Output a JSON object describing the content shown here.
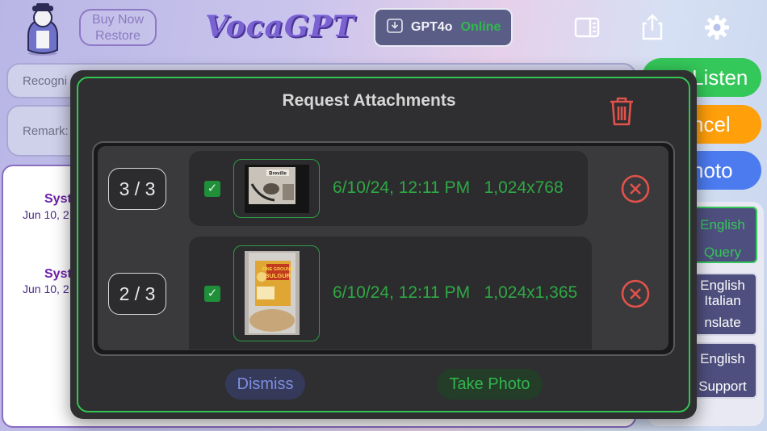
{
  "header": {
    "buy_now": "Buy Now",
    "restore": "Restore",
    "logo": "VocaGPT",
    "model_name": "GPT4o",
    "model_status": "Online"
  },
  "background": {
    "recognize_placeholder": "Recogni",
    "remark_label": "Remark:",
    "entries": [
      {
        "name": "Syst",
        "date": "Jun 10, 2"
      },
      {
        "name": "Syst",
        "date": "Jun 10, 2"
      }
    ],
    "side_buttons": [
      "Listen",
      "ncel",
      "hoto"
    ],
    "lang_buttons": [
      {
        "line1": "English",
        "line2": "Query"
      },
      {
        "line1": "English",
        "line2": "Italian",
        "line3": "nslate"
      },
      {
        "line1": "English",
        "line2": "Support"
      }
    ]
  },
  "modal": {
    "title": "Request Attachments",
    "attachments": [
      {
        "counter": "3 / 3",
        "date": "6/10/24, 12:11 PM",
        "size": "1,024x768",
        "checked": true,
        "thumb": "Breville appliance"
      },
      {
        "counter": "2 / 3",
        "date": "6/10/24, 12:11 PM",
        "size": "1,024x1,365",
        "checked": true,
        "thumb": "Fine Ground Bulgur bag"
      }
    ],
    "dismiss_label": "Dismiss",
    "take_photo_label": "Take Photo",
    "check_glyph": "✓"
  },
  "colors": {
    "accent_green": "#33c553",
    "danger_red": "#e0524a",
    "listen": "#34c759",
    "cancel": "#ff9f0a",
    "photo": "#4c7bf0"
  },
  "icons": [
    "avatar-icon",
    "download-icon",
    "sidebar-toggle-icon",
    "share-icon",
    "gear-icon",
    "trash-icon",
    "remove-circle-icon"
  ]
}
